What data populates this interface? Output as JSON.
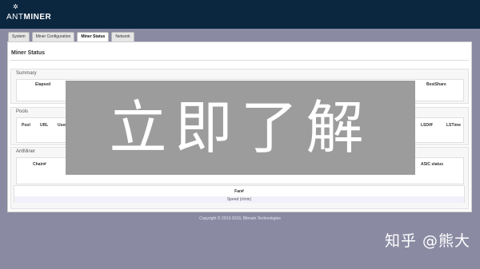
{
  "header": {
    "logo_prefix": "ANT",
    "logo_suffix": "MINER"
  },
  "tabs": [
    {
      "label": "System"
    },
    {
      "label": "Miner Configuration"
    },
    {
      "label": "Miner Status",
      "active": true
    },
    {
      "label": "Network"
    }
  ],
  "page_title": "Miner Status",
  "summary": {
    "label": "Summary",
    "columns": {
      "elapsed": "Elapsed",
      "bestshare": "BestShare"
    }
  },
  "pools": {
    "label": "Pools",
    "columns": {
      "pool": "Pool",
      "url": "URL",
      "user": "User",
      "lsdiff": "LSDiff",
      "lstime": "LSTime"
    }
  },
  "antminer": {
    "label": "AntMiner",
    "columns": {
      "chain": "Chain#",
      "asic_status": "ASIC status"
    },
    "fan": {
      "title": "Fan#",
      "speed_label": "Speed (r/min)"
    }
  },
  "footer": {
    "copyright": "Copyright © 2013-2018, Bitmain Technologies"
  },
  "overlay": {
    "text": "立即了解"
  },
  "watermark": {
    "text": "知乎 @熊大"
  },
  "colors": {
    "header_bg": "#0b2740",
    "page_bg": "#8b8aa3",
    "overlay_bg": "#9c9c9c"
  }
}
